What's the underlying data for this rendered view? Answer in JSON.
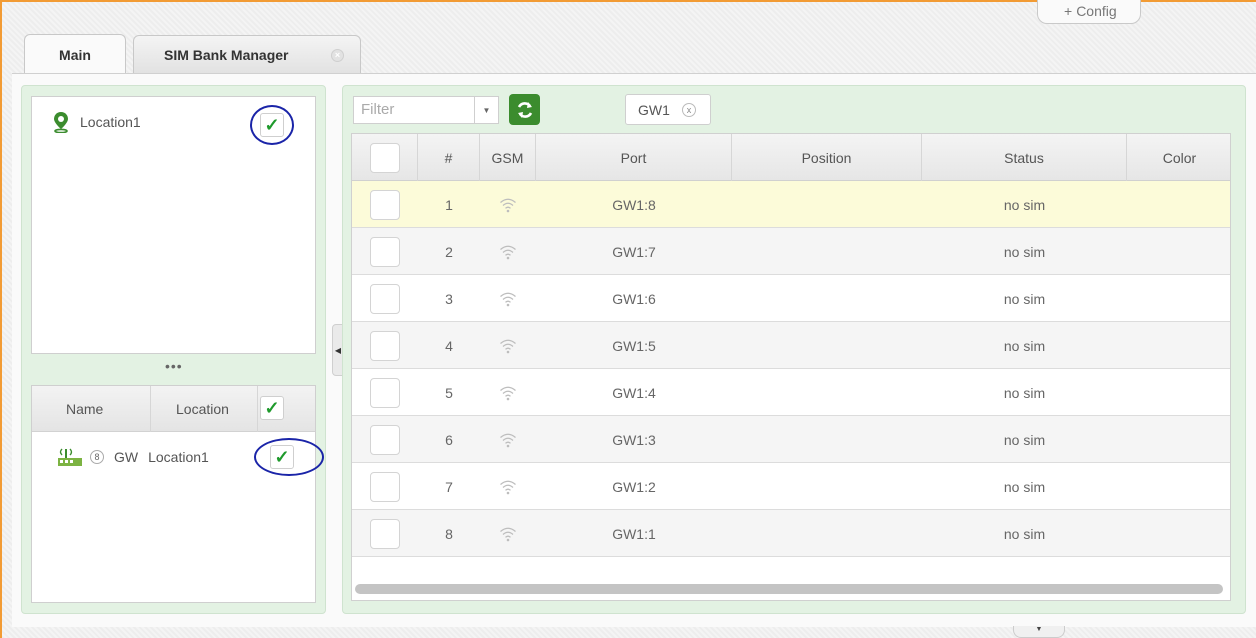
{
  "header": {
    "config_label": "Config"
  },
  "tabs": [
    {
      "label": "Main"
    },
    {
      "label": "SIM Bank Manager",
      "close": "×"
    }
  ],
  "locations": {
    "items": [
      {
        "label": "Location1",
        "checked": "✓"
      }
    ],
    "more": "•••"
  },
  "gateways": {
    "columns": [
      "Name",
      "Location"
    ],
    "header_check": "✓",
    "rows": [
      {
        "badge": "8",
        "name": "GW",
        "location": "Location1",
        "checked": "✓"
      }
    ]
  },
  "filter": {
    "placeholder": "Filter",
    "dropdown": "▼",
    "chip_label": "GW1",
    "chip_remove": "x"
  },
  "ports_table": {
    "columns": [
      "#",
      "GSM",
      "Port",
      "Position",
      "Status",
      "Color"
    ],
    "rows": [
      {
        "num": "1",
        "port": "GW1:8",
        "status": "no sim"
      },
      {
        "num": "2",
        "port": "GW1:7",
        "status": "no sim"
      },
      {
        "num": "3",
        "port": "GW1:6",
        "status": "no sim"
      },
      {
        "num": "4",
        "port": "GW1:5",
        "status": "no sim"
      },
      {
        "num": "5",
        "port": "GW1:4",
        "status": "no sim"
      },
      {
        "num": "6",
        "port": "GW1:3",
        "status": "no sim"
      },
      {
        "num": "7",
        "port": "GW1:2",
        "status": "no sim"
      },
      {
        "num": "8",
        "port": "GW1:1",
        "status": "no sim"
      }
    ]
  },
  "colors": {
    "accent_green": "#3b8c2e",
    "selected_row": "#fcfbd9",
    "panel_bg": "#e3f2e3",
    "annotation_circle": "#1a24a8",
    "window_border": "#f29b34"
  }
}
